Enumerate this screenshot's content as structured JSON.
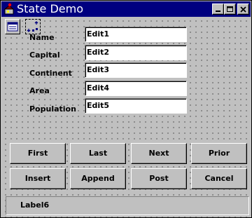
{
  "window": {
    "title": "State Demo",
    "controls": [
      "minimize-icon",
      "maximize-icon",
      "close-icon"
    ]
  },
  "form": {
    "fields": [
      {
        "label": "Name",
        "value": "Edit1"
      },
      {
        "label": "Capital",
        "value": "Edit2"
      },
      {
        "label": "Continent",
        "value": "Edit3"
      },
      {
        "label": "Area",
        "value": "Edit4"
      },
      {
        "label": "Population",
        "value": "Edit5"
      }
    ],
    "buttons_row1": [
      "First",
      "Last",
      "Next",
      "Prior"
    ],
    "buttons_row2": [
      "Insert",
      "Append",
      "Post",
      "Cancel"
    ]
  },
  "status": {
    "text": "Label6"
  },
  "colors": {
    "titlebar": "#000080",
    "face": "#c0c0c0"
  }
}
